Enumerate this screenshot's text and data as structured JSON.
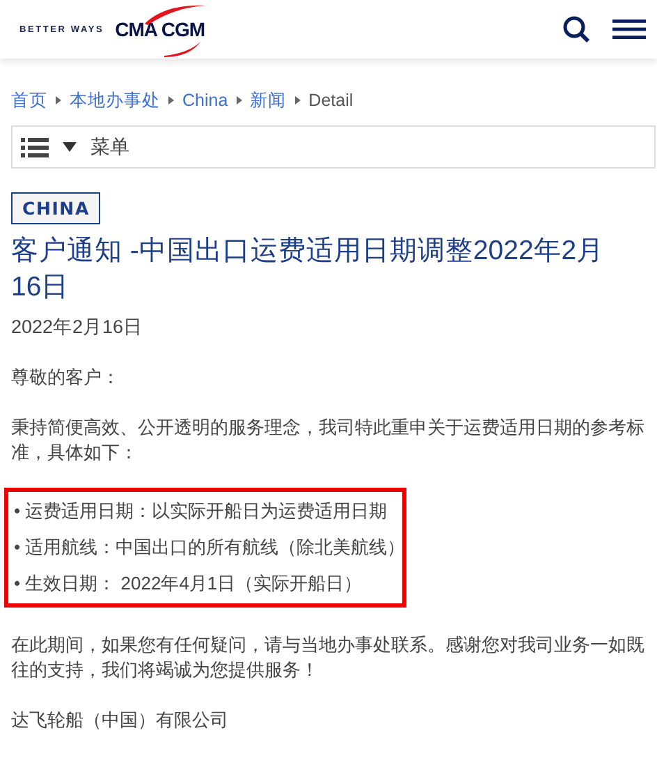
{
  "header": {
    "tagline": "BETTER WAYS",
    "brand": "CMA CGM"
  },
  "breadcrumb": [
    {
      "label": "首页",
      "link": true
    },
    {
      "label": "本地办事处",
      "link": true
    },
    {
      "label": "China",
      "link": true
    },
    {
      "label": "新闻",
      "link": true
    },
    {
      "label": "Detail",
      "link": false
    }
  ],
  "menu": {
    "label": "菜单"
  },
  "tag": "CHINA",
  "title": "客户通知 -中国出口运费适用日期调整2022年2月16日",
  "date": "2022年2月16日",
  "paragraphs_before": [
    "尊敬的客户：",
    "秉持简便高效、公开透明的服务理念，我司特此重申关于运费适用日期的参考标准，具体如下："
  ],
  "highlighted_list": [
    "• 运费适用日期：以实际开船日为运费适用日期",
    "• 适用航线：中国出口的所有航线（除北美航线）",
    "• 生效日期： 2022年4月1日（实际开船日）"
  ],
  "paragraphs_after": [
    "在此期间，如果您有任何疑问，请与当地办事处联系。感谢您对我司业务一如既往的支持，我们将竭诚为您提供服务！",
    "达飞轮船（中国）有限公司"
  ]
}
